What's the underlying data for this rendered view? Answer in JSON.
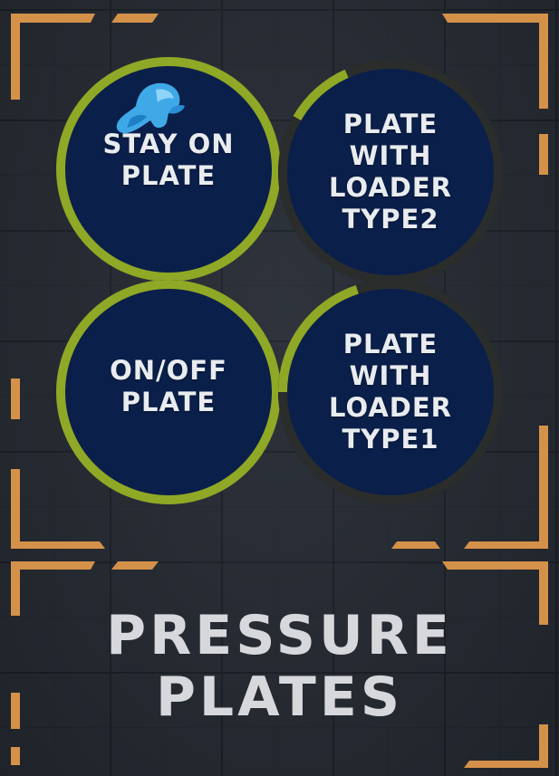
{
  "colors": {
    "accent_orange": "#d4914a",
    "ring_green": "#8fa826",
    "ring_track": "#2a2d2b",
    "plate_fill": "#0a1f4a",
    "text": "#e9ecef"
  },
  "plates": [
    {
      "label": "STAY ON\nPLATE",
      "progress": 1.0,
      "has_character": true
    },
    {
      "label": "PLATE\nWITH\nLOADER\nTYPE2",
      "progress": 0.1
    },
    {
      "label": "ON/OFF\nPLATE",
      "progress": 1.0
    },
    {
      "label": "PLATE\nWITH\nLOADER\nTYPE1",
      "progress": 0.2
    }
  ],
  "section": {
    "title": "PRESSURE\nPLATES"
  },
  "icons": {
    "character": "blue-character-icon"
  }
}
